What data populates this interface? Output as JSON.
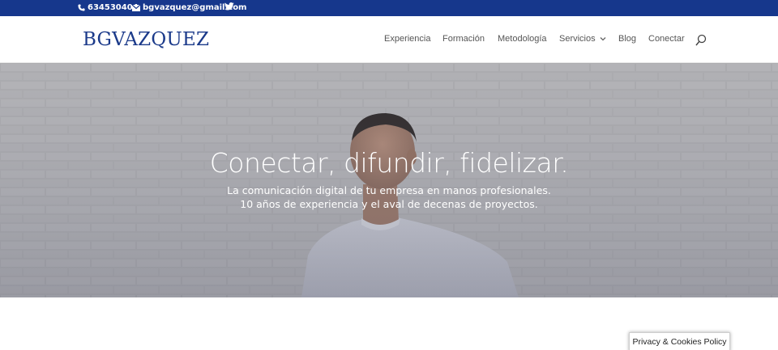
{
  "colors": {
    "topbar": "#16378c",
    "brand": "#1b3a8a",
    "nav_text": "#555555"
  },
  "topbar": {
    "phone": "634530404",
    "email": "bgvazquez@gmail.com",
    "phone_icon": "phone-icon",
    "email_icon": "envelope-icon",
    "social_icon": "twitter-icon"
  },
  "header": {
    "logo": "BGVAZQUEZ",
    "nav": [
      {
        "label": "Experiencia"
      },
      {
        "label": "Formación"
      },
      {
        "label": "Metodología"
      },
      {
        "label": "Servicios",
        "has_dropdown": true
      },
      {
        "label": "Blog"
      },
      {
        "label": "Conectar"
      }
    ],
    "search_icon": "search-icon"
  },
  "hero": {
    "title": "Conectar, difundir, fidelizar.",
    "subtitle_line1": "La comunicación digital de tu empresa en manos profesionales.",
    "subtitle_line2": "10 años de experiencia y el aval de decenas de proyectos."
  },
  "privacy": {
    "label": "Privacy & Cookies Policy"
  }
}
